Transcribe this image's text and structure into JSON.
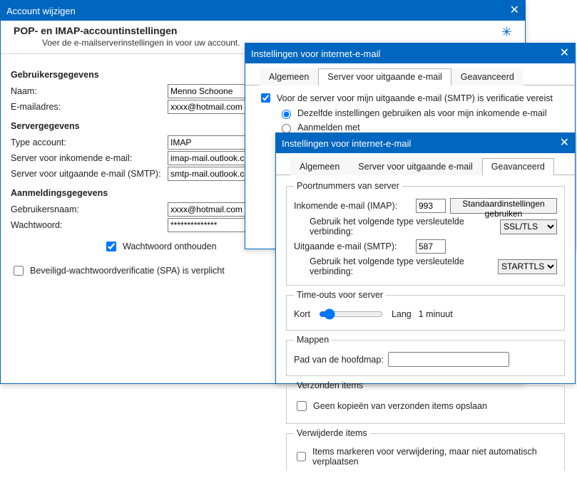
{
  "w1": {
    "title": "Account wijzigen",
    "header_title": "POP- en IMAP-accountinstellingen",
    "header_sub": "Voer de e-mailserverinstellingen in voor uw account.",
    "sec_user": "Gebruikersgegevens",
    "name_lbl": "Naam:",
    "name_val": "Menno Schoone",
    "email_lbl": "E-mailadres:",
    "email_val": "xxxx@hotmail.com",
    "sec_server": "Servergegevens",
    "type_lbl": "Type account:",
    "type_val": "IMAP",
    "in_lbl": "Server voor inkomende e-mail:",
    "in_val": "imap-mail.outlook.com",
    "out_lbl": "Server voor uitgaande e-mail (SMTP):",
    "out_val": "smtp-mail.outlook.com",
    "sec_login": "Aanmeldingsgegevens",
    "user_lbl": "Gebruikersnaam:",
    "user_val": "xxxx@hotmail.com",
    "pw_lbl": "Wachtwoord:",
    "pw_val": "**************",
    "remember_pw": "Wachtwoord onthouden",
    "spa_lbl": "Beveiligd-wachtwoordverificatie (SPA) is verplicht"
  },
  "w2": {
    "title": "Instellingen voor internet-e-mail",
    "tab_general": "Algemeen",
    "tab_outgoing": "Server voor uitgaande e-mail",
    "tab_adv": "Geavanceerd",
    "auth_required": "Voor de server voor mijn uitgaande e-mail (SMTP) is verificatie vereist",
    "same_settings": "Dezelfde instellingen gebruiken als voor mijn inkomende e-mail",
    "login_with": "Aanmelden met"
  },
  "w3": {
    "title": "Instellingen voor internet-e-mail",
    "tab_general": "Algemeen",
    "tab_outgoing": "Server voor uitgaande e-mail",
    "tab_adv": "Geavanceerd",
    "fs_ports": "Poortnummers van server",
    "in_lbl": "Inkomende e-mail (IMAP):",
    "in_port": "993",
    "defaults_btn": "Standaardinstellingen gebruiken",
    "enc_lbl": "Gebruik het volgende type versleutelde verbinding:",
    "enc_in": "SSL/TLS",
    "out_lbl": "Uitgaande e-mail (SMTP):",
    "out_port": "587",
    "enc_out": "STARTTLS",
    "fs_timeout": "Time-outs voor server",
    "short_lbl": "Kort",
    "long_lbl": "Lang",
    "timeout_val": "1 minuut",
    "fs_folders": "Mappen",
    "rootpath_lbl": "Pad van de hoofdmap:",
    "rootpath_val": "",
    "fs_sent": "Verzonden items",
    "sent_no_copy": "Geen kopieën van verzonden items opslaan",
    "fs_deleted": "Verwijderde items",
    "del_mark": "Items markeren voor verwijdering, maar niet automatisch verplaatsen"
  }
}
